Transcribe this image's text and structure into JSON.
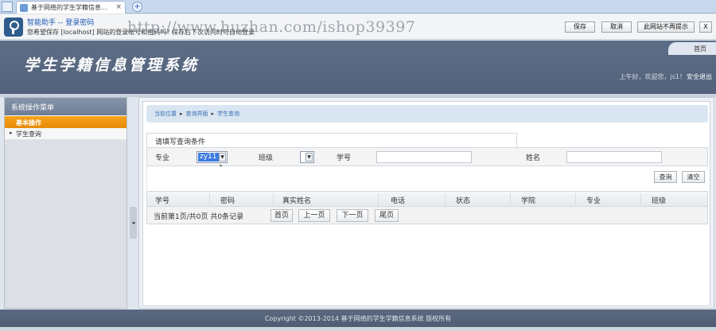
{
  "browser": {
    "tab_title": "基于网络的学生学籍信息...",
    "tab_close": "×",
    "new_tab": "+"
  },
  "password_bar": {
    "title": "智能助手 -- 登录密码",
    "description": "您希望保存 [localhost] 网站的登录帐号和密码吗? 保存后下次访问时可自动登录",
    "watermark": "http://www.huzhan.com/ishop39397",
    "save": "保存",
    "cancel": "取消",
    "never": "此网站不再提示",
    "close": "X"
  },
  "header": {
    "title": "学生学籍信息管理系统",
    "home_tab": "首页",
    "greeting": "上午好，欢迎您，js1！",
    "logout": "安全退出"
  },
  "sidebar": {
    "title": "系统操作菜单",
    "group": "基本操作",
    "items": [
      {
        "label": "学生查询"
      }
    ],
    "collapse_icon": "◂"
  },
  "breadcrumb": {
    "current": "当前位置",
    "level1": "查询界面",
    "level2": "学生查询",
    "sep": "▸"
  },
  "query": {
    "heading": "请填写查询条件",
    "major_label": "专业",
    "major_value": "zy11",
    "class_label": "班级",
    "class_value": "",
    "student_no_label": "学号",
    "student_no_value": "",
    "name_label": "姓名",
    "name_value": "",
    "select_arrow": "▼",
    "search_button": "查询",
    "clear_button": "清空"
  },
  "table": {
    "columns": [
      "学号",
      "密码",
      "真实姓名",
      "电话",
      "状态",
      "学院",
      "专业",
      "班级"
    ],
    "rows": []
  },
  "pager": {
    "info": "当前第1页/共0页  共0条记录",
    "first": "首页",
    "prev": "上一页",
    "next": "下一页",
    "last": "尾页"
  },
  "footer": {
    "copyright": "Copyright ©2013-2014 基于网络的学生学籍信息系统 版权所有"
  }
}
